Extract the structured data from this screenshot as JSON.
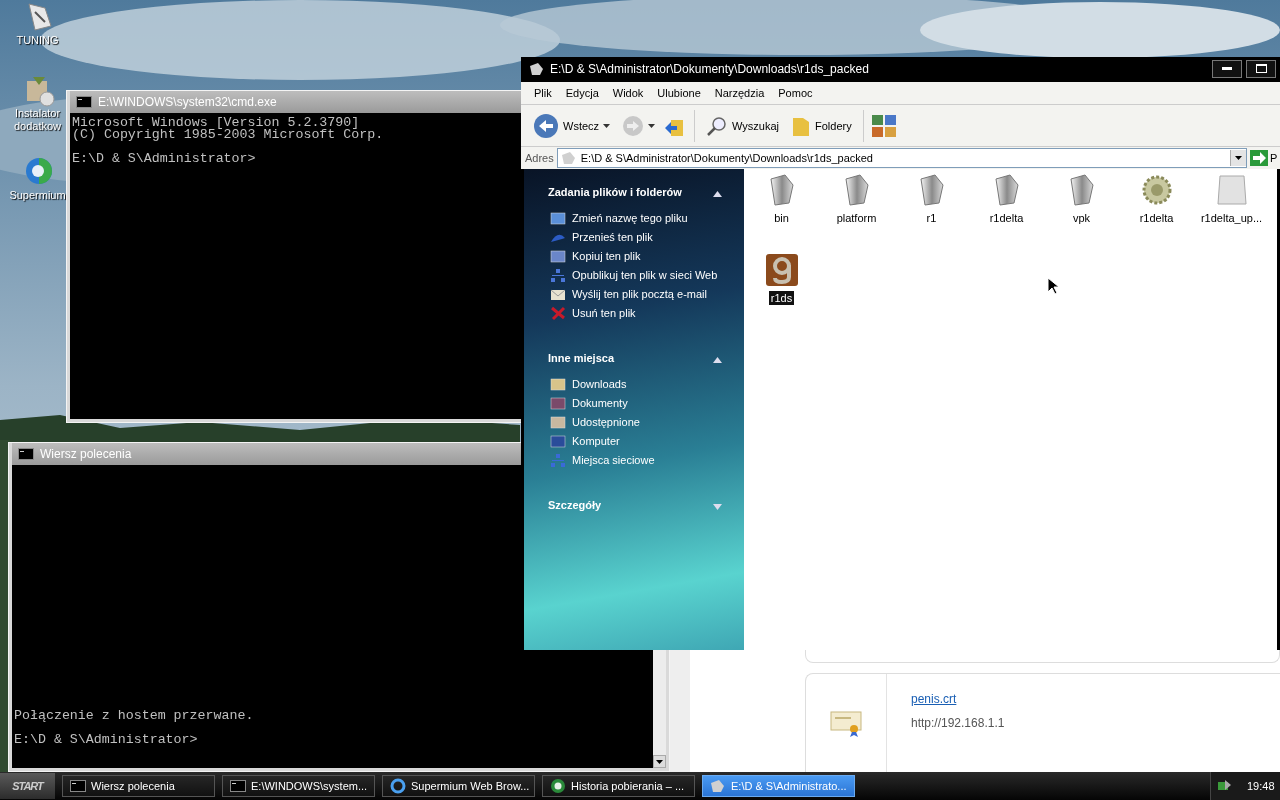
{
  "desktop_icons": [
    {
      "label": "TUNING",
      "kind": "tool"
    },
    {
      "label": "Instalator dodatkow",
      "kind": "installer"
    },
    {
      "label": "Supermium",
      "kind": "browser"
    }
  ],
  "console_window": {
    "title": "E:\\WINDOWS\\system32\\cmd.exe",
    "lines": [
      "Microsoft Windows [Version 5.2.3790]",
      "(C) Copyright 1985-2003 Microsoft Corp."
    ],
    "prompt": "E:\\D & S\\Administrator>"
  },
  "command_prompt": {
    "title": "Wiersz polecenia",
    "lines": [
      "Połączenie z hostem przerwane."
    ],
    "prompt": "E:\\D & S\\Administrator>"
  },
  "browser": {
    "download": {
      "file_name": "penis.crt",
      "url": "http://192.168.1.1"
    }
  },
  "explorer": {
    "title": "E:\\D & S\\Administrator\\Dokumenty\\Downloads\\r1ds_packed",
    "menu": [
      "Plik",
      "Edycja",
      "Widok",
      "Ulubione",
      "Narzędzia",
      "Pomoc"
    ],
    "toolbar": {
      "back": "Wstecz",
      "search": "Wyszukaj",
      "folders": "Foldery"
    },
    "address": {
      "label": "Adres",
      "value": "E:\\D & S\\Administrator\\Dokumenty\\Downloads\\r1ds_packed",
      "go": "P"
    },
    "task_panes": [
      {
        "title": "Zadania plików i folderów",
        "expanded": true,
        "items": [
          {
            "label": "Zmień nazwę tego pliku",
            "kind": "rename"
          },
          {
            "label": "Przenieś ten plik",
            "kind": "move"
          },
          {
            "label": "Kopiuj ten plik",
            "kind": "copy"
          },
          {
            "label": "Opublikuj ten plik w sieci Web",
            "kind": "publish"
          },
          {
            "label": "Wyślij ten plik pocztą e-mail",
            "kind": "email"
          },
          {
            "label": "Usuń ten plik",
            "kind": "delete"
          }
        ]
      },
      {
        "title": "Inne miejsca",
        "expanded": true,
        "items": [
          {
            "label": "Downloads",
            "kind": "folder"
          },
          {
            "label": "Dokumenty",
            "kind": "documents"
          },
          {
            "label": "Udostępnione",
            "kind": "shared"
          },
          {
            "label": "Komputer",
            "kind": "computer"
          },
          {
            "label": "Miejsca sieciowe",
            "kind": "network"
          }
        ]
      },
      {
        "title": "Szczegóły",
        "expanded": false
      }
    ],
    "files": [
      {
        "name": "bin",
        "kind": "folder",
        "selected": false
      },
      {
        "name": "platform",
        "kind": "folder",
        "selected": false
      },
      {
        "name": "r1",
        "kind": "folder",
        "selected": false
      },
      {
        "name": "r1delta",
        "kind": "folder",
        "selected": false
      },
      {
        "name": "vpk",
        "kind": "folder",
        "selected": false
      },
      {
        "name": "r1delta",
        "kind": "program",
        "selected": false
      },
      {
        "name": "r1delta_up...",
        "kind": "blank",
        "selected": false
      },
      {
        "name": "r1ds",
        "kind": "app",
        "selected": true
      }
    ]
  },
  "taskbar": {
    "start": "START",
    "buttons": [
      {
        "label": "Wiersz polecenia",
        "kind": "console",
        "active": false
      },
      {
        "label": "E:\\WINDOWS\\system...",
        "kind": "console",
        "active": false
      },
      {
        "label": "Supermium Web Brow...",
        "kind": "web",
        "active": false
      },
      {
        "label": "Historia pobierania – ...",
        "kind": "globe",
        "active": false
      },
      {
        "label": "E:\\D & S\\Administrato...",
        "kind": "explorer",
        "active": true
      }
    ],
    "clock": "19:48"
  }
}
